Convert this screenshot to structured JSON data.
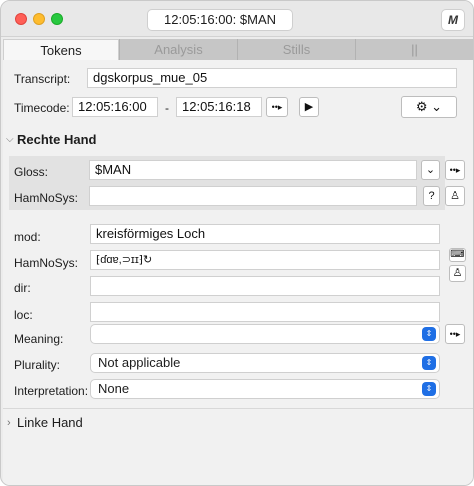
{
  "window": {
    "title": "12:05:16:00: $MAN",
    "mode_button": "M"
  },
  "tabs": [
    {
      "label": "Tokens",
      "active": true
    },
    {
      "label": "Analysis",
      "active": false
    },
    {
      "label": "Stills",
      "active": false
    },
    {
      "label": "||",
      "active": false
    }
  ],
  "transcript": {
    "label": "Transcript:",
    "value": "dgskorpus_mue_05"
  },
  "timecode": {
    "label": "Timecode:",
    "start": "12:05:16:00",
    "separator": "-",
    "end": "12:05:16:18",
    "jump_button": "••▸",
    "play_button": "▶",
    "gear_button": "⚙ ⌄"
  },
  "rechte_hand": {
    "title": "Rechte Hand",
    "gloss": {
      "label": "Gloss:",
      "value": "$MAN",
      "dropdown_glyph": "⌄",
      "jump_button": "••▸"
    },
    "hamnosys": {
      "label": "HamNoSys:",
      "value": "",
      "help_button": "?",
      "figure_button": "♙"
    },
    "mod": {
      "label": "mod:",
      "value": "kreisförmiges Loch"
    },
    "hamnosys2": {
      "label": "HamNoSys:",
      "value": "⁅ɗɑɐ,⊃ɪɪ⁆↻",
      "keyboard_button": "⌨",
      "figure_button": "♙"
    },
    "dir": {
      "label": "dir:",
      "value": ""
    },
    "loc": {
      "label": "loc:",
      "value": ""
    },
    "meaning": {
      "label": "Meaning:",
      "value": "",
      "jump_button": "••▸"
    },
    "plurality": {
      "label": "Plurality:",
      "value": "Not applicable"
    },
    "interpretation": {
      "label": "Interpretation:",
      "value": "None"
    }
  },
  "linke_hand": {
    "title": "Linke Hand"
  },
  "colors": {
    "accent": "#1f6fe5",
    "tab_inactive": "#c6c6c6",
    "panel": "#e2e2e2"
  }
}
